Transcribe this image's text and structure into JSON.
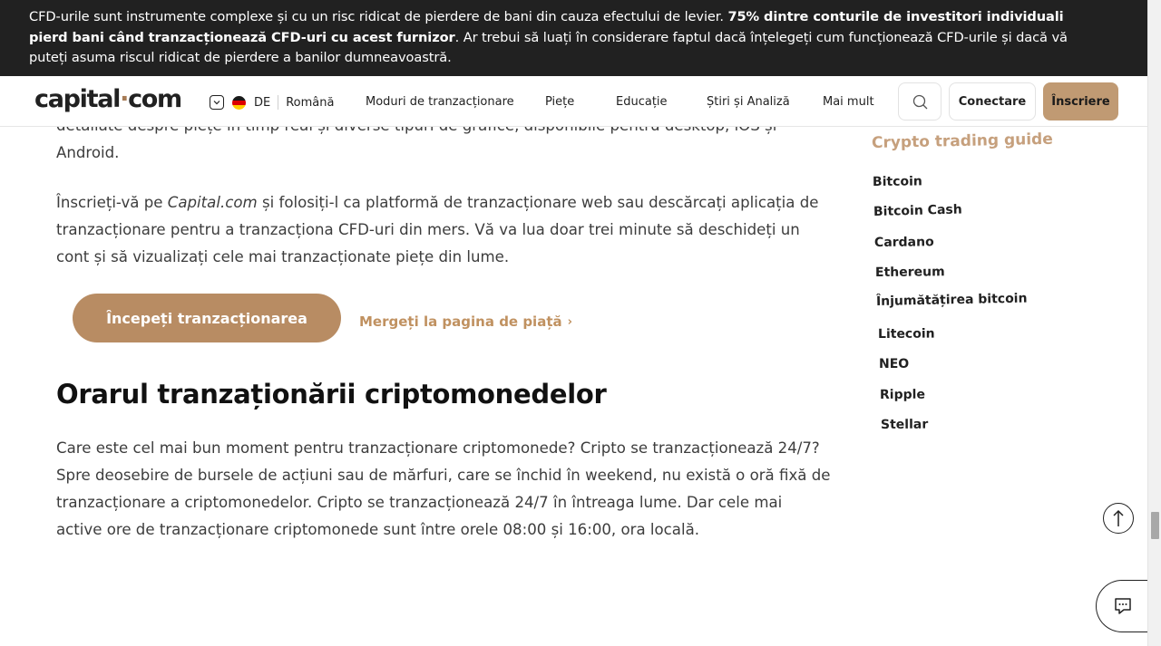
{
  "risk_banner": {
    "text_before": "CFD-urile sunt instrumente complexe și cu un risc ridicat de pierdere de bani din cauza efectului de levier. ",
    "text_bold": "75% dintre conturile de investitori individuali pierd bani când tranzacționează CFD-uri cu acest furnizor",
    "text_after": ". Ar trebui să luați în considerare faptul dacă înțelegeți cum funcționează CFD-urile și dacă vă puteți asuma riscul ridicat de pierdere a banilor dumneavoastră."
  },
  "header": {
    "logo_left": "capital",
    "logo_dot": "·",
    "logo_right": "com",
    "country_code": "DE",
    "language": "Română",
    "nav": [
      "Moduri de tranzacționare",
      "Piețe",
      "Educație",
      "Știri și Analiză",
      "Mai mult"
    ],
    "login_label": "Conectare",
    "signup_label": "Înscriere"
  },
  "article": {
    "partial_line_1": "detaliate despre piețe în timp real și diverse tipuri de grafice, disponibile pentru desktop, iOS și",
    "partial_line_2": "Android.",
    "para2_before": "Înscrieți-vă pe ",
    "para2_italic": "Capital.com",
    "para2_after": " și folosiți-l ca platformă de tranzacționare web sau descărcați aplicația de tranzacționare pentru a tranzacționa CFD-uri din mers. Vă va lua doar trei minute să deschideți un cont și să vizualizați cele mai tranzacționate piețe din lume.",
    "cta_label": "Începeți tranzacționarea",
    "market_link_label": "Mergeți la pagina de piață",
    "section_title": "Orarul tranzaționării criptomonedelor",
    "para3": "Care este cel mai bun moment pentru tranzacționare criptomonede? Cripto se tranzacționează 24/7? Spre deosebire de bursele de acțiuni sau de mărfuri, care se închid în weekend, nu există o oră fixă de tranzacționare a criptomonedelor. Cripto se tranzacționează 24/7 în întreaga lume. Dar cele mai active ore de tranzacționare criptomonede sunt între orele 08:00 și 16:00, ora locală."
  },
  "sidebar": {
    "title": "Crypto trading guide",
    "items": [
      "Bitcoin",
      "Bitcoin Cash",
      "Cardano",
      "Ethereum",
      "Înjumătățirea bitcoin",
      "Litecoin",
      "NEO",
      "Ripple",
      "Stellar"
    ]
  },
  "icons": {
    "search": "search-icon",
    "arrow_up": "arrow-up-icon",
    "chat": "chat-icon",
    "chevron": "chevron-down-icon",
    "flag": "germany-flag-icon"
  },
  "colors": {
    "brand": "#b88c63",
    "banner_bg": "#212121",
    "link": "#c09160"
  }
}
